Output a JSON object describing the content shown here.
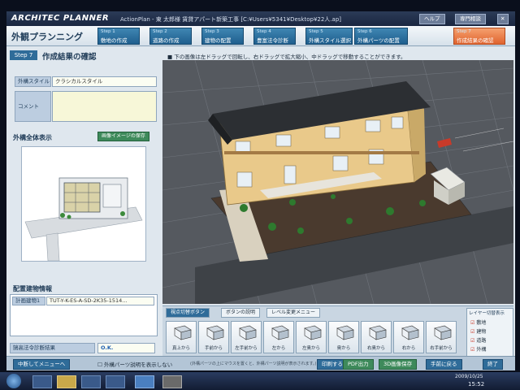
{
  "app": {
    "logo": "ARCHITEC PLANNER",
    "title_text": "ActionPlan - 東 太郎様 賃貸アパート新築工事 [C:¥Users¥5341¥Desktop¥22人.ap]",
    "help_label": "ヘルプ",
    "support_label": "専門相談"
  },
  "header": {
    "page_title": "外観プランニング",
    "steps": [
      {
        "num": "Step 1",
        "label": "敷地の作成"
      },
      {
        "num": "Step 2",
        "label": "道路の作成"
      },
      {
        "num": "Step 3",
        "label": "建物の配置"
      },
      {
        "num": "Step 4",
        "label": "豊富法令診断"
      },
      {
        "num": "Step 5",
        "label": "外構スタイル選択"
      },
      {
        "num": "Step 6",
        "label": "外構パーツの配置"
      },
      {
        "num": "Step 7",
        "label": "作成結果の確認"
      }
    ]
  },
  "left": {
    "step_badge": "Step 7",
    "step_title": "作成結果の確認",
    "style_label": "外構スタイル",
    "style_value": "クラシカルスタイル",
    "comment_label": "コメント",
    "comment_value": "",
    "overview_title": "外構全体表示",
    "save_image_label": "画像イメージの保存",
    "info_title": "配置建物情報",
    "plan_label": "計画建物1",
    "plan_value": "TUT-Y-K-ES-A-SD-2K35-1514...",
    "diag_label": "鵠高法令診断結果",
    "diag_value": "O.K."
  },
  "view": {
    "note": "■ 下の画像は左ドラッグで回転し、右ドラッグで拡大縮小、中ドラッグで移動することができます。"
  },
  "camera": {
    "tabs": [
      "視点切替ボタン",
      "ボタンの説明",
      "レベル変更メニュー"
    ],
    "buttons": [
      "真上から",
      "手前から",
      "左手前から",
      "左から",
      "左奥から",
      "奥から",
      "右奥から",
      "右から",
      "右手前から"
    ],
    "layer_title": "レイヤー切替表示",
    "layers": [
      "敷地",
      "建物",
      "道路",
      "外構"
    ]
  },
  "footer": {
    "menu_label": "中断してメニューへ",
    "checkbox_label": "外構パーツ説明を表示しない",
    "hint_text": "(外構パーツの上にマウスを置くと、外構パーツ説明が表示されます。)",
    "btn_print": "印刷する",
    "btn_pdf": "PDF出力",
    "btn_3d": "3D画像保存",
    "btn_prev": "手前に戻る",
    "btn_finish": "終了"
  },
  "taskbar": {
    "time": "15:52",
    "date": "2009/10/25"
  },
  "colors": {
    "step_active": "#e0642f",
    "step_normal": "#1f5f8e",
    "building_wall": "#e9c98a",
    "roof": "#2c2f33"
  }
}
